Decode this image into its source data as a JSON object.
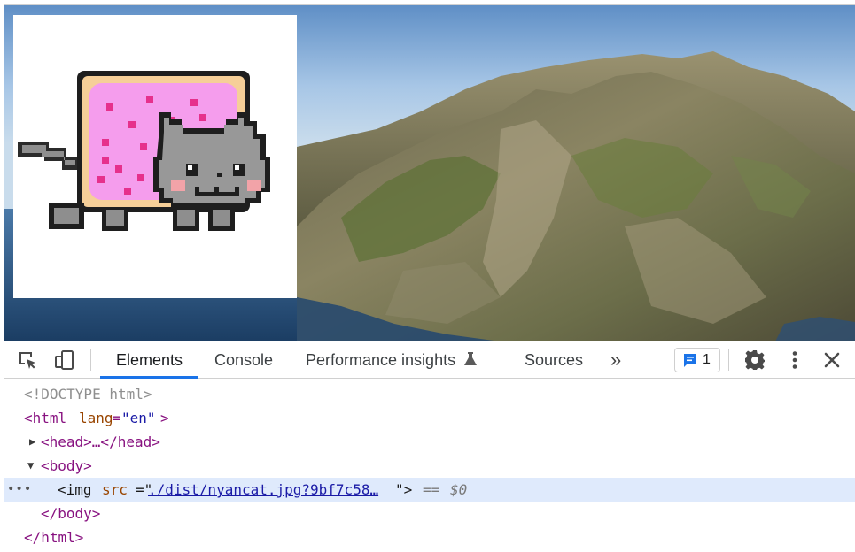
{
  "devtools": {
    "tabs": [
      {
        "label": "Elements",
        "active": true
      },
      {
        "label": "Console",
        "active": false
      },
      {
        "label": "Performance insights",
        "active": false
      },
      {
        "label": "Sources",
        "active": false
      }
    ],
    "more_tabs_label": "»",
    "issues_count": "1",
    "icons": {
      "inspect": "inspect-element-icon",
      "device": "device-toolbar-icon",
      "flask": "flask-icon",
      "issues": "message-icon",
      "settings": "gear-icon",
      "menu": "kebab-menu-icon",
      "close": "close-icon"
    },
    "colors": {
      "accent": "#1a73e8",
      "selected_row": "#dfeafc"
    }
  },
  "elements_tree": {
    "doctype": "<!DOCTYPE html>",
    "html_open_tag": "<html",
    "html_attr_name": "lang",
    "html_attr_value": "\"en\"",
    "html_open_end": ">",
    "head_collapsed": "<head>…</head>",
    "body_open": "<body>",
    "img_tag_open": "<img",
    "img_attr_name": "src",
    "img_attr_eq": "=\"",
    "img_src": "./dist/nyancat.jpg?9bf7c58…",
    "img_tag_close": "\">",
    "eq_marker": "==",
    "dollar_ref": "$0",
    "body_close": "</body>",
    "html_close": "</html>",
    "row_dots": "•••"
  }
}
